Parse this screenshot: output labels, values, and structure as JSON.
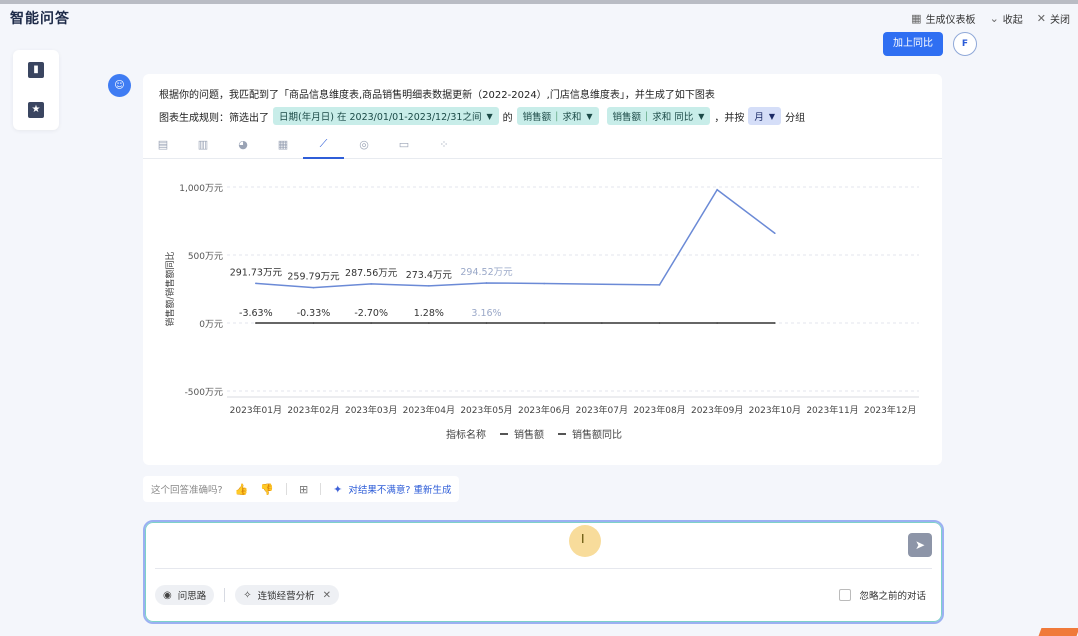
{
  "app": {
    "title": "智能问答"
  },
  "header_actions": [
    {
      "icon": "dashboard-icon",
      "label": "生成仪表板"
    },
    {
      "icon": "collapse-icon",
      "label": "收起"
    },
    {
      "icon": "close-icon",
      "label": "关闭"
    }
  ],
  "top_right": {
    "compare_button": "加上同比",
    "avatar": "F"
  },
  "answer": {
    "intro": "根据你的问题，我匹配到了「商品信息维度表,商品销售明细表数据更新（2022-2024）,门店信息维度表」，并生成了如下图表",
    "rule_prefix": "图表生成规则：筛选出了",
    "filter_chip": {
      "field": "日期(年月日)",
      "op": "在",
      "value": "2023/01/01-2023/12/31之间"
    },
    "de": "的",
    "metric1": {
      "name": "销售额",
      "agg": "求和"
    },
    "metric2": {
      "name": "销售额",
      "agg": "求和 同比"
    },
    "group_prefix": "，并按",
    "group_chip": "月",
    "group_suffix": "分组"
  },
  "chart_tabs": [
    "table-icon",
    "bar-chart-icon",
    "pie-chart-icon",
    "column-chart-icon",
    "line-chart-icon",
    "map-icon",
    "card-icon",
    "scatter-icon"
  ],
  "chart_data": {
    "type": "line",
    "ylabel": "销售额/销售额同比",
    "y_tick_labels": [
      "1,000万元",
      "500万元",
      "0万元",
      "-500万元"
    ],
    "y_ticks": [
      1000,
      500,
      0,
      -500
    ],
    "ylim": [
      -500,
      1000
    ],
    "categories": [
      "2023年01月",
      "2023年02月",
      "2023年03月",
      "2023年04月",
      "2023年05月",
      "2023年06月",
      "2023年07月",
      "2023年08月",
      "2023年09月",
      "2023年10月",
      "2023年11月",
      "2023年12月"
    ],
    "series": [
      {
        "name": "销售额",
        "color": "#6b8ad6",
        "values": [
          291.73,
          259.79,
          287.56,
          273.4,
          294.52,
          290,
          285,
          280,
          980,
          660
        ],
        "labels": [
          "291.73万元",
          "259.79万元",
          "287.56万元",
          "273.4万元",
          "294.52万元"
        ]
      },
      {
        "name": "销售额同比",
        "color": "#333333",
        "values": [
          0,
          0,
          0,
          0,
          0,
          0,
          0,
          0,
          0,
          0
        ],
        "labels": [
          "-3.63%",
          "-0.33%",
          "-2.70%",
          "1.28%",
          "3.16%"
        ]
      }
    ],
    "legend_title": "指标名称",
    "legend": [
      "销售额",
      "销售额同比"
    ],
    "grid": true
  },
  "feedback": {
    "question": "这个回答准确吗?",
    "regen": "对结果不满意? 重新生成"
  },
  "input": {
    "pill1": "问思路",
    "pill2": "连锁经营分析",
    "ignore": "忽略之前的对话"
  }
}
